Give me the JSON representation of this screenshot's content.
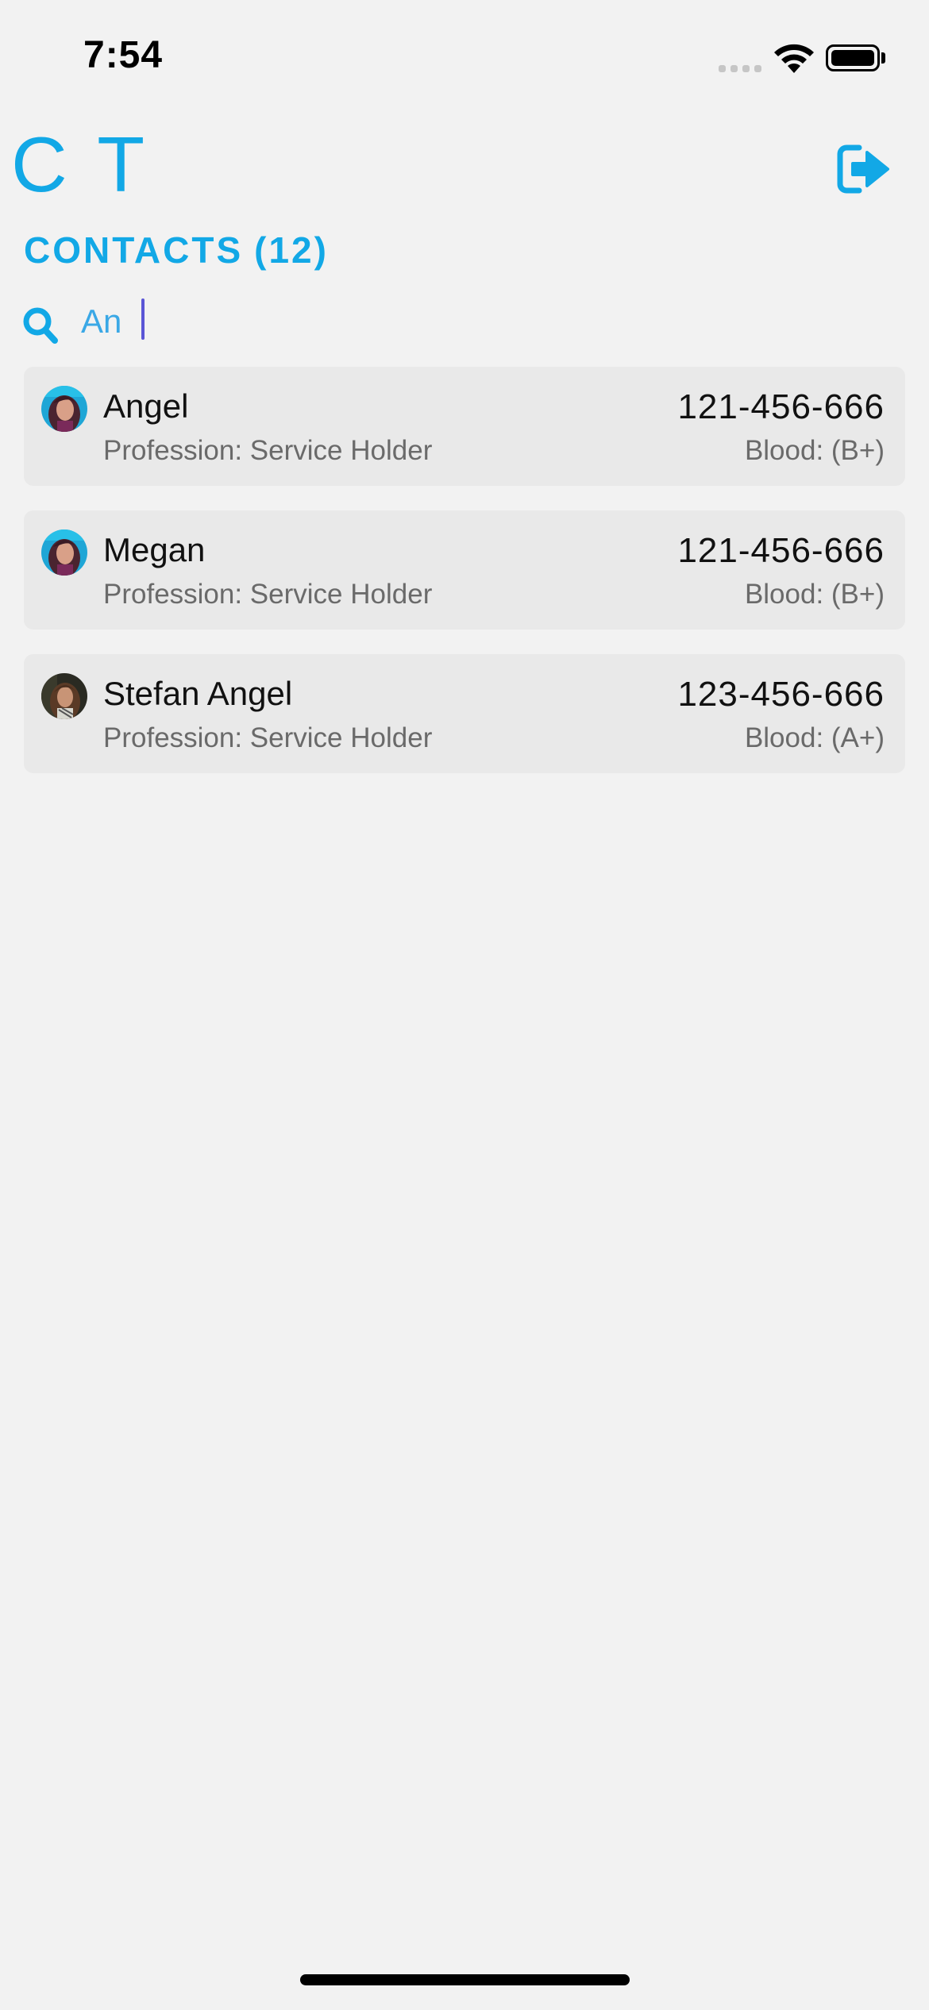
{
  "status": {
    "time": "7:54"
  },
  "header": {
    "brand": "C T",
    "logout_icon": "logout-icon"
  },
  "contacts": {
    "title": "CONTACTS",
    "count": "(12)"
  },
  "search": {
    "value": "An",
    "icon": "search-icon"
  },
  "items": [
    {
      "name": "Angel",
      "profession": "Profession: Service Holder",
      "phone": "121-456-666",
      "blood": "Blood: (B+)"
    },
    {
      "name": "Megan",
      "profession": "Profession: Service Holder",
      "phone": "121-456-666",
      "blood": "Blood: (B+)"
    },
    {
      "name": "Stefan Angel",
      "profession": "Profession: Service Holder",
      "phone": "123-456-666",
      "blood": "Blood: (A+)"
    }
  ],
  "colors": {
    "accent": "#12a8e6",
    "background": "#f2f2f2",
    "card": "#e9e9e9",
    "caret": "#5b56d6"
  }
}
